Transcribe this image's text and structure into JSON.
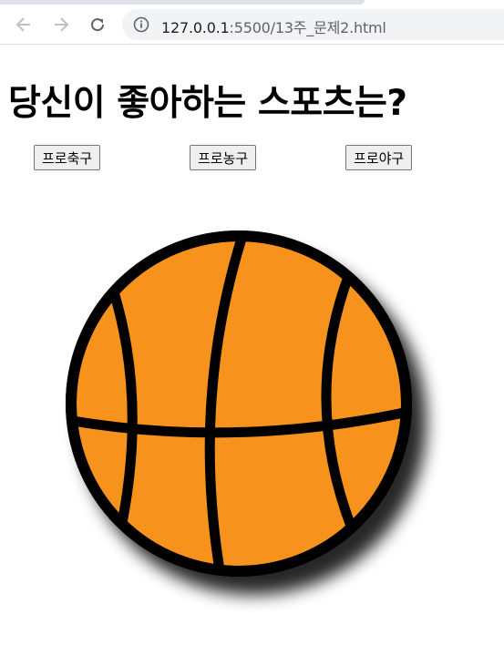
{
  "browser": {
    "url_host": "127.0.0.1",
    "url_rest": ":5500/13주_문제2.html"
  },
  "page": {
    "title": "당신이 좋아하는 스포츠는?"
  },
  "buttons": {
    "soccer_label": "프로축구",
    "basketball_label": "프로농구",
    "baseball_label": "프로야구"
  },
  "image": {
    "ball_color": "#f7931e",
    "line_color": "#000000"
  }
}
